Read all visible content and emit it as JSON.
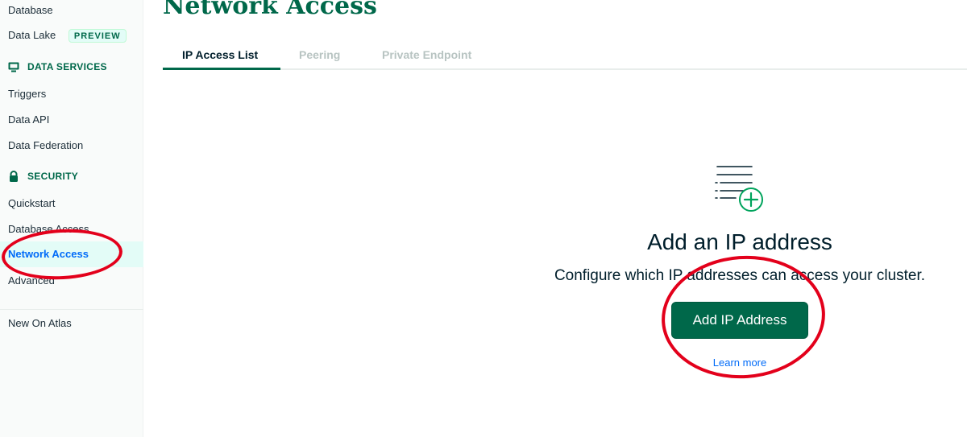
{
  "sidebar": {
    "items_top": [
      {
        "label": "Database"
      },
      {
        "label": "Data Lake",
        "badge": "PREVIEW"
      }
    ],
    "data_services": {
      "heading": "DATA SERVICES",
      "items": [
        {
          "label": "Triggers"
        },
        {
          "label": "Data API"
        },
        {
          "label": "Data Federation"
        }
      ]
    },
    "security": {
      "heading": "SECURITY",
      "items": [
        {
          "label": "Quickstart"
        },
        {
          "label": "Database Access"
        },
        {
          "label": "Network Access",
          "active": true
        },
        {
          "label": "Advanced"
        }
      ]
    },
    "footer_item": {
      "label": "New On Atlas"
    }
  },
  "main": {
    "title": "Network Access",
    "tabs": [
      {
        "label": "IP Access List",
        "active": true
      },
      {
        "label": "Peering"
      },
      {
        "label": "Private Endpoint"
      }
    ],
    "empty_state": {
      "icon": "list-add-icon",
      "title": "Add an IP address",
      "description": "Configure which IP addresses can access your cluster.",
      "button_label": "Add IP Address",
      "link_label": "Learn more"
    }
  },
  "colors": {
    "brand_green": "#00684a",
    "accent_green": "#00ed64",
    "link_blue": "#016bf8",
    "annotation_red": "#e3001b"
  }
}
